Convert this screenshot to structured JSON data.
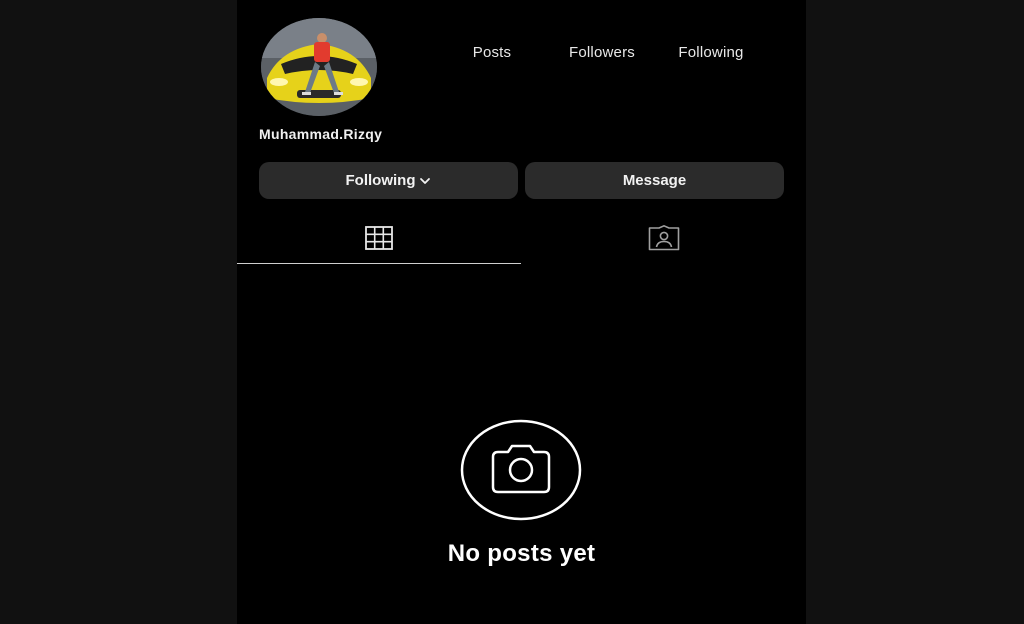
{
  "profile": {
    "username": "Muhammad.Rizqy",
    "stats": {
      "posts_label": "Posts",
      "followers_label": "Followers",
      "following_label": "Following"
    }
  },
  "actions": {
    "following_label": "Following",
    "message_label": "Message"
  },
  "tabs": [
    {
      "icon": "grid-icon",
      "active": true
    },
    {
      "icon": "tagged-icon",
      "active": false
    }
  ],
  "empty_state": {
    "icon": "camera-icon",
    "text": "No posts yet"
  },
  "colors": {
    "background": "#000000",
    "button": "#2b2b2b",
    "text": "#f2f2f2"
  }
}
